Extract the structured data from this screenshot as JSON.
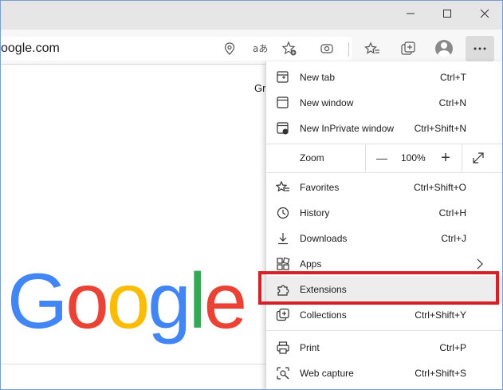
{
  "address_bar": {
    "url": "oogle.com"
  },
  "page": {
    "partial_text": "Gr",
    "logo_letters": [
      {
        "ch": "G",
        "color": "#4285F4"
      },
      {
        "ch": "o",
        "color": "#EA4335"
      },
      {
        "ch": "o",
        "color": "#FBBC05"
      },
      {
        "ch": "g",
        "color": "#4285F4"
      },
      {
        "ch": "l",
        "color": "#34A853"
      },
      {
        "ch": "e",
        "color": "#EA4335"
      }
    ]
  },
  "menu": {
    "new_tab": {
      "label": "New tab",
      "shortcut": "Ctrl+T"
    },
    "new_window": {
      "label": "New window",
      "shortcut": "Ctrl+N"
    },
    "new_inprivate": {
      "label": "New InPrivate window",
      "shortcut": "Ctrl+Shift+N"
    },
    "zoom": {
      "label": "Zoom",
      "value": "100%",
      "minus": "—",
      "plus": "+"
    },
    "favorites": {
      "label": "Favorites",
      "shortcut": "Ctrl+Shift+O"
    },
    "history": {
      "label": "History",
      "shortcut": "Ctrl+H"
    },
    "downloads": {
      "label": "Downloads",
      "shortcut": "Ctrl+J"
    },
    "apps": {
      "label": "Apps"
    },
    "extensions": {
      "label": "Extensions"
    },
    "collections": {
      "label": "Collections",
      "shortcut": "Ctrl+Shift+Y"
    },
    "print": {
      "label": "Print",
      "shortcut": "Ctrl+P"
    },
    "web_capture": {
      "label": "Web capture",
      "shortcut": "Ctrl+Shift+S"
    }
  },
  "colors": {
    "highlight_border": "#d42027",
    "title_bar": "#e6e6e6",
    "toolbar": "#f7f7f7"
  },
  "icons": [
    "minimize-icon",
    "maximize-icon",
    "close-icon",
    "location-icon",
    "read-aloud-icon",
    "add-favorite-icon",
    "tracking-icon",
    "favorites-icon",
    "collections-icon",
    "avatar",
    "more-icon"
  ]
}
